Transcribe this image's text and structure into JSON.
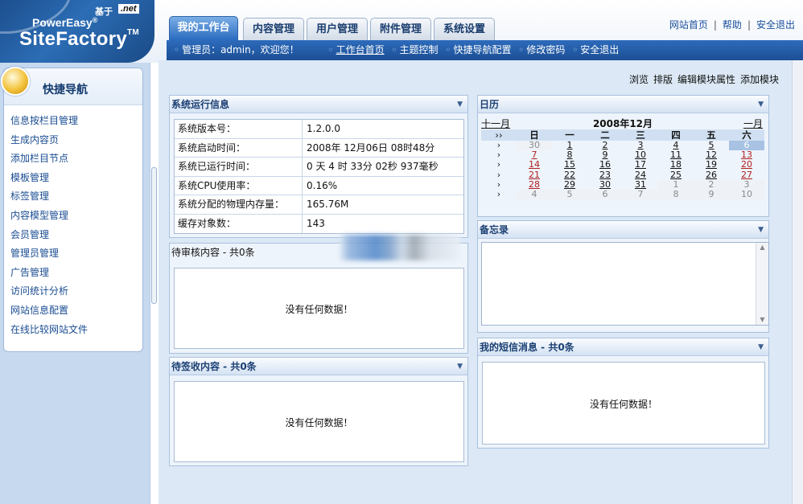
{
  "header": {
    "logo_brand": "PowerEasy",
    "logo_reg": "®",
    "logo_product": "SiteFactory",
    "logo_tm": "TM",
    "based_on": "基于",
    "net_badge": ".net",
    "tabs": [
      {
        "label": "我的工作台",
        "active": true
      },
      {
        "label": "内容管理",
        "active": false
      },
      {
        "label": "用户管理",
        "active": false
      },
      {
        "label": "附件管理",
        "active": false
      },
      {
        "label": "系统设置",
        "active": false
      }
    ],
    "toplinks": [
      "网站首页",
      "帮助",
      "安全退出"
    ],
    "separator": "|"
  },
  "subnav": {
    "welcome": "管理员：admin，欢迎您！",
    "links": [
      "工作台首页",
      "主题控制",
      "快捷导航配置",
      "修改密码",
      "安全退出"
    ],
    "bullet": "◦"
  },
  "sidebar": {
    "title": "快捷导航",
    "items": [
      "信息按栏目管理",
      "生成内容页",
      "添加栏目节点",
      "模板管理",
      "标签管理",
      "内容模型管理",
      "会员管理",
      "管理员管理",
      "广告管理",
      "访问统计分析",
      "网站信息配置",
      "在线比较网站文件"
    ]
  },
  "module_links": [
    "浏览",
    "排版",
    "编辑模块属性",
    "添加模块"
  ],
  "modules": {
    "sysinfo": {
      "title": "系统运行信息",
      "rows": [
        {
          "key": "系统版本号：",
          "value": "1.2.0.0"
        },
        {
          "key": "系统启动时间：",
          "value": "2008年 12月06日 08时48分"
        },
        {
          "key": "系统已运行时间：",
          "value": "0 天 4 时 33分 02秒 937毫秒"
        },
        {
          "key": "系统CPU使用率：",
          "value": "0.16%"
        },
        {
          "key": "系统分配的物理内存量：",
          "value": "165.76M"
        },
        {
          "key": "缓存对象数：",
          "value": "143"
        }
      ]
    },
    "pending_review": {
      "title": "待审核内容 - 共0条",
      "empty": "没有任何数据！"
    },
    "pending_sign": {
      "title": "待签收内容 - 共0条",
      "empty": "没有任何数据！"
    },
    "calendar": {
      "title": "日历",
      "prev": "十一月",
      "next": "一月",
      "month_title": "2008年12月",
      "week_col": "››",
      "weekdays": [
        "日",
        "一",
        "二",
        "三",
        "四",
        "五",
        "六"
      ],
      "week_marker": "›",
      "weeks": [
        [
          "30",
          "1",
          "2",
          "3",
          "4",
          "5",
          "6"
        ],
        [
          "7",
          "8",
          "9",
          "10",
          "11",
          "12",
          "13"
        ],
        [
          "14",
          "15",
          "16",
          "17",
          "18",
          "19",
          "20"
        ],
        [
          "21",
          "22",
          "23",
          "24",
          "25",
          "26",
          "27"
        ],
        [
          "28",
          "29",
          "30",
          "31",
          "1",
          "2",
          "3"
        ],
        [
          "4",
          "5",
          "6",
          "7",
          "8",
          "9",
          "10"
        ]
      ],
      "other_month_cells": [
        [
          0,
          0
        ],
        [
          4,
          4
        ],
        [
          4,
          5
        ],
        [
          4,
          6
        ],
        [
          5,
          0
        ],
        [
          5,
          1
        ],
        [
          5,
          2
        ],
        [
          5,
          3
        ],
        [
          5,
          4
        ],
        [
          5,
          5
        ],
        [
          5,
          6
        ]
      ],
      "selected_cell": [
        0,
        6
      ]
    },
    "memo": {
      "title": "备忘录",
      "scroll_up": "▲",
      "scroll_down": "▼"
    },
    "messages": {
      "title": "我的短信消息 - 共0条",
      "empty": "没有任何数据！"
    }
  },
  "colors": {
    "nav_blue": "#1c4f95",
    "tab_active": "#2a6bbf",
    "panel_bg": "#dce8f5",
    "weekend_red": "#b01f1f"
  }
}
